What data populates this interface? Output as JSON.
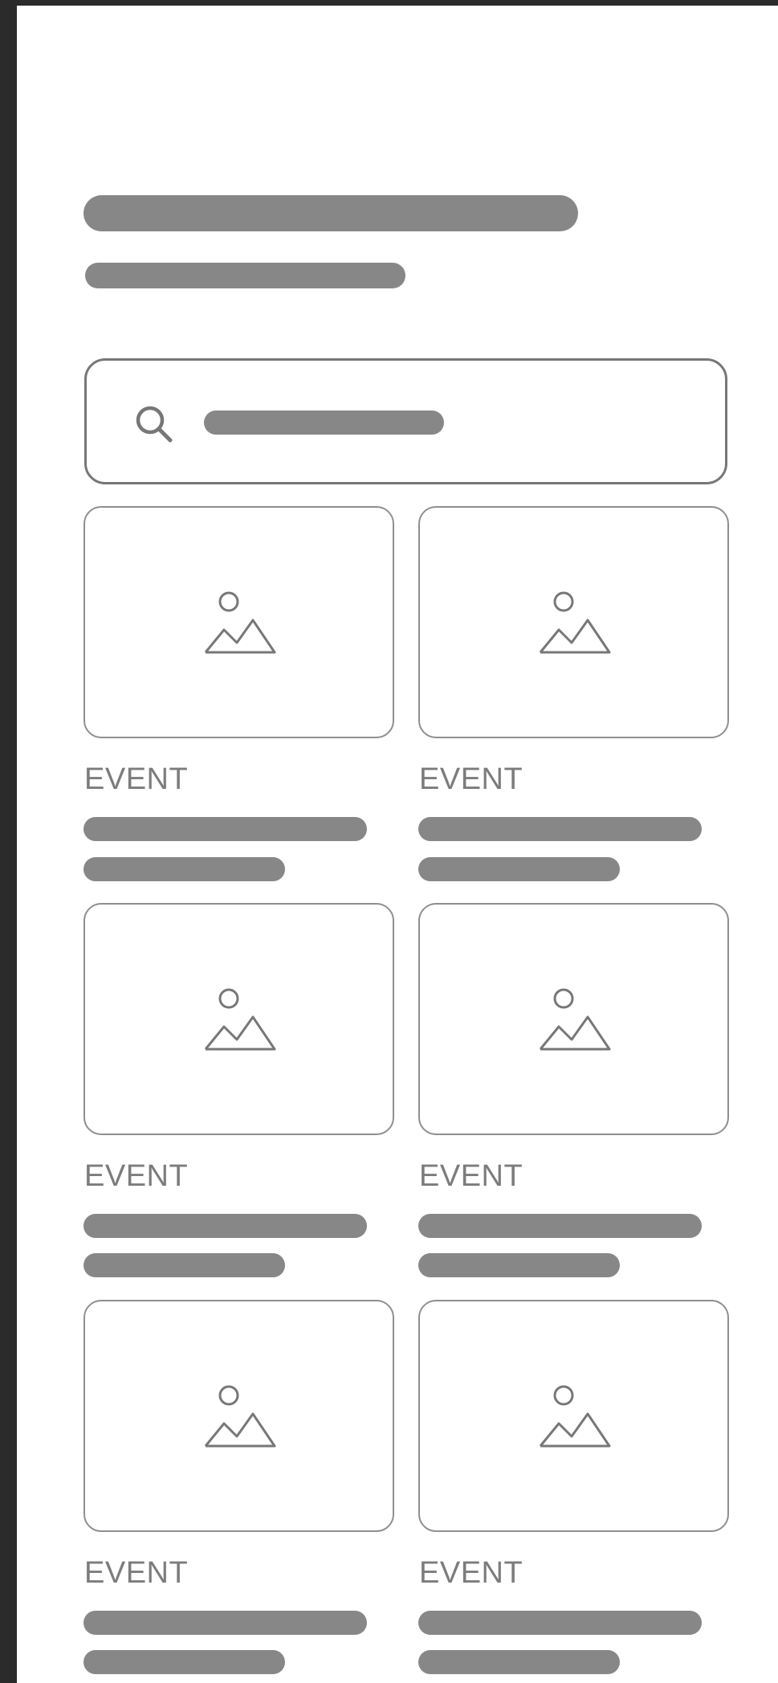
{
  "events": [
    {
      "label": "EVENT",
      "image_icon": "image-icon"
    },
    {
      "label": "EVENT",
      "image_icon": "image-icon"
    },
    {
      "label": "EVENT",
      "image_icon": "image-icon"
    },
    {
      "label": "EVENT",
      "image_icon": "image-icon"
    },
    {
      "label": "EVENT",
      "image_icon": "image-icon"
    },
    {
      "label": "EVENT",
      "image_icon": "image-icon"
    }
  ],
  "search": {
    "icon": "search-icon"
  },
  "colors": {
    "background": "#2b2b2b",
    "screen": "#ffffff",
    "placeholder": "#878787",
    "border": "#8f8f8f",
    "label": "#7c7c7c"
  }
}
